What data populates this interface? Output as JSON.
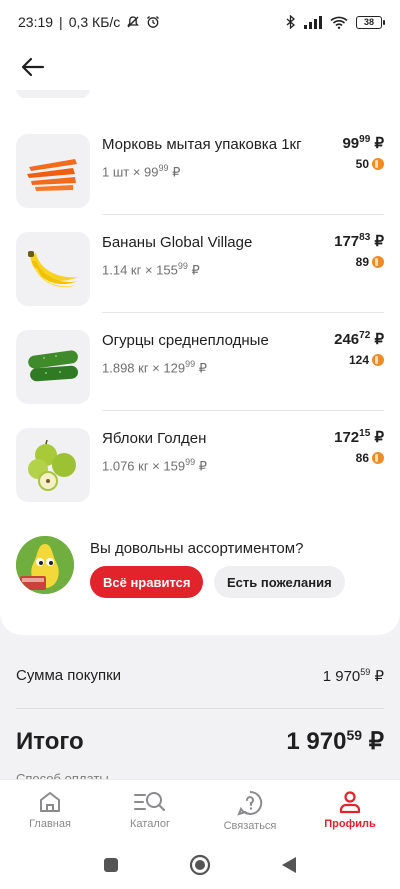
{
  "status_bar": {
    "time": "23:19",
    "net_speed": "0,3 КБ/с",
    "battery": "38"
  },
  "products": [
    {
      "name": "Морковь мытая упаковка 1кг",
      "qty_prefix": "1 шт × 99",
      "qty_kop": "99",
      "qty_cur": "₽",
      "price_rub": "99",
      "price_kop": "99",
      "price_cur": "₽",
      "bonus": "50",
      "icon": "carrots-icon"
    },
    {
      "name": "Бананы Global Village",
      "qty_prefix": "1.14 кг × 155",
      "qty_kop": "99",
      "qty_cur": "₽",
      "price_rub": "177",
      "price_kop": "83",
      "price_cur": "₽",
      "bonus": "89",
      "icon": "bananas-icon"
    },
    {
      "name": "Огурцы среднеплодные",
      "qty_prefix": "1.898 кг × 129",
      "qty_kop": "99",
      "qty_cur": "₽",
      "price_rub": "246",
      "price_kop": "72",
      "price_cur": "₽",
      "bonus": "124",
      "icon": "cucumbers-icon"
    },
    {
      "name": "Яблоки Голден",
      "qty_prefix": "1.076 кг × 159",
      "qty_kop": "99",
      "qty_cur": "₽",
      "price_rub": "172",
      "price_kop": "15",
      "price_cur": "₽",
      "bonus": "86",
      "icon": "apples-icon"
    }
  ],
  "feedback": {
    "question": "Вы довольны ассортиментом?",
    "like_label": "Всё нравится",
    "wish_label": "Есть пожелания"
  },
  "summary": {
    "sum_label": "Сумма покупки",
    "sum_rub": "1 970",
    "sum_kop": "59",
    "sum_cur": "₽",
    "total_label": "Итого",
    "total_rub": "1 970",
    "total_kop": "59",
    "total_cur": "₽",
    "payment_label": "Способ оплаты"
  },
  "bottom_nav": [
    {
      "label": "Главная",
      "icon": "home-icon"
    },
    {
      "label": "Каталог",
      "icon": "catalog-search-icon"
    },
    {
      "label": "Связаться",
      "icon": "help-chat-icon"
    },
    {
      "label": "Профиль",
      "icon": "profile-icon",
      "active": true
    }
  ],
  "colors": {
    "accent": "#e3232c",
    "bonus_coin": "#f08a24",
    "background": "#f2f2f4"
  }
}
